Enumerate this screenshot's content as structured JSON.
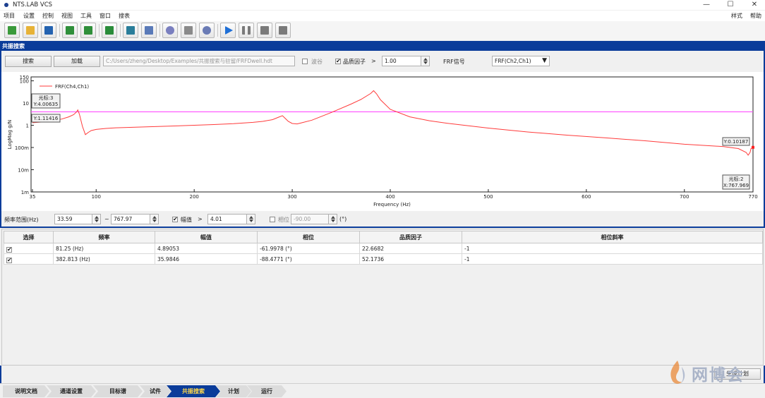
{
  "app": {
    "title": "NTS.LAB VCS"
  },
  "window_controls": {
    "minimize": "—",
    "maximize": "☐",
    "close": "✕"
  },
  "menu": {
    "items": [
      "项目",
      "设置",
      "控制",
      "视图",
      "工具",
      "窗口",
      "搜表"
    ],
    "right_items": [
      "样式",
      "帮助"
    ]
  },
  "toolbar": {
    "icons": [
      "new-doc-icon",
      "open-folder-icon",
      "save-icon",
      "download-green-icon",
      "download-green2-icon",
      "export-icon",
      "chart-icon",
      "report-icon",
      "database-icon",
      "eraser-icon",
      "gear-icon",
      "play-icon",
      "pause-icon",
      "stop-icon",
      "disk-gray-icon"
    ],
    "icon_colors": [
      "#3a9a3a",
      "#e7b236",
      "#2563b0",
      "#2f8f3a",
      "#2f8f3a",
      "#2a8c3a",
      "#2a7d9a",
      "#5a7ab8",
      "#7a7fbf",
      "#8a8a8a",
      "#6a7bb5",
      "#1f6fd6",
      "#7a7a7a",
      "#7a7a7a",
      "#7a7a7a"
    ]
  },
  "panel": {
    "title": "共振搜索"
  },
  "controls": {
    "search_label": "搜索",
    "load_label": "加载",
    "path_value": "C:/Users/zheng/Desktop/Examples/共振搜索与驻留/FRFDwell.hdt",
    "wave_valley_label": "波谷",
    "wave_valley_checked": false,
    "quality_label": "品质因子",
    "quality_op": ">",
    "quality_value": "1.00",
    "frf_signal_label": "FRF信号",
    "frf_signal_value": "FRF(Ch2,Ch1)"
  },
  "chart_data": {
    "type": "line",
    "title": "",
    "xlabel": "Frequency (Hz)",
    "ylabel": "LogMag g/N",
    "x_scale": "linear",
    "y_scale": "log",
    "xlim": [
      33.59,
      770
    ],
    "ylim": [
      0.001,
      150
    ],
    "x_ticks": [
      35,
      100,
      200,
      300,
      400,
      500,
      600,
      700,
      770
    ],
    "x_tick_labels": [
      "35",
      "100",
      "200",
      "300",
      "400",
      "500",
      "600",
      "700",
      "770"
    ],
    "y_ticks": [
      0.001,
      0.01,
      0.1,
      1,
      10,
      100,
      150
    ],
    "y_tick_labels": [
      "1m",
      "10m",
      "100m",
      "1",
      "10",
      "100",
      "150"
    ],
    "legend": {
      "entries": [
        "FRF(Ch4,Ch1)"
      ],
      "placement": "top-left"
    },
    "series": [
      {
        "name": "FRF(Ch4,Ch1)",
        "color": "#ff3b3b",
        "x": [
          35,
          45,
          55,
          65,
          72,
          77,
          80,
          81.25,
          83,
          86,
          89,
          92,
          95,
          100,
          110,
          120,
          140,
          160,
          180,
          200,
          220,
          240,
          260,
          270,
          280,
          286,
          290,
          293,
          296,
          300,
          305,
          310,
          320,
          340,
          360,
          370,
          380,
          383,
          386,
          390,
          400,
          420,
          440,
          460,
          480,
          500,
          540,
          580,
          620,
          660,
          700,
          740,
          755,
          763,
          765,
          767,
          768,
          770
        ],
        "y": [
          1.3,
          1.4,
          1.6,
          1.9,
          2.4,
          3.0,
          4.0,
          4.89,
          3.1,
          0.9,
          0.38,
          0.48,
          0.58,
          0.65,
          0.72,
          0.77,
          0.82,
          0.87,
          0.93,
          1.0,
          1.08,
          1.18,
          1.35,
          1.5,
          1.8,
          2.3,
          2.7,
          2.0,
          1.5,
          1.2,
          1.15,
          1.3,
          1.7,
          3.8,
          9.0,
          14.5,
          27,
          35.98,
          26,
          14,
          5.2,
          2.4,
          1.6,
          1.2,
          0.95,
          0.75,
          0.5,
          0.36,
          0.27,
          0.2,
          0.14,
          0.11,
          0.09,
          0.06,
          0.045,
          0.06,
          0.09,
          0.10187
        ]
      }
    ],
    "threshold": {
      "value": 4.01,
      "color": "#ff40ff"
    },
    "cursors": [
      {
        "label": "光标:3",
        "y_text": "Y:4.00635"
      },
      {
        "y_text": "Y:1.11416"
      },
      {
        "y_text": "Y:0.10187"
      },
      {
        "label": "光标:2",
        "x_text": "X:767.969"
      }
    ]
  },
  "range": {
    "label": "频率范围(Hz)",
    "min": "33.59",
    "sep": "~",
    "max": "767.97",
    "amp_label": "幅值",
    "amp_checked": true,
    "amp_op": ">",
    "amp_value": "4.01",
    "phase_label": "相位",
    "phase_checked": false,
    "phase_value": "-90.00",
    "phase_unit": "(°)"
  },
  "table": {
    "headers": [
      "选择",
      "频率",
      "幅值",
      "相位",
      "品质因子",
      "相位斜率"
    ],
    "rows": [
      {
        "checked": true,
        "cells": [
          "81.25 (Hz)",
          "4.89053",
          "-61.9978 (°)",
          "22.6682",
          "-1"
        ]
      },
      {
        "checked": true,
        "cells": [
          "382.813 (Hz)",
          "35.9846",
          "-88.4771 (°)",
          "52.1736",
          "-1"
        ]
      }
    ]
  },
  "gen_plan_label": "生成计划",
  "tabs": [
    "说明文档",
    "通道设置",
    "目标谱",
    "试件",
    "共振搜索",
    "计划",
    "运行"
  ],
  "active_tab": 4,
  "watermark": {
    "text": "网博会"
  }
}
